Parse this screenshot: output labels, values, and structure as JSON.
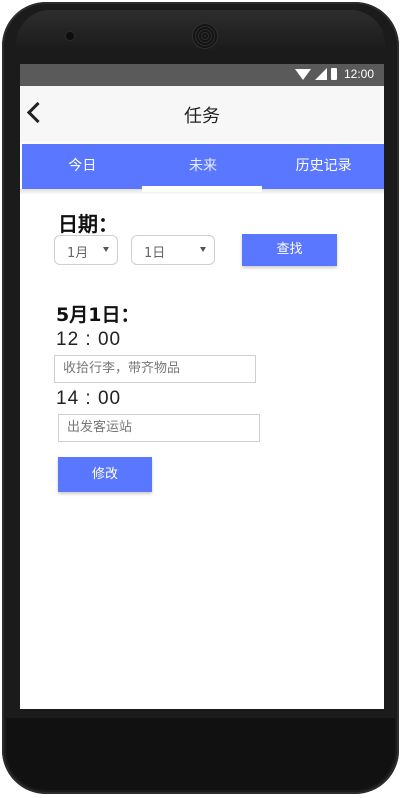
{
  "statusbar": {
    "time": "12:00"
  },
  "header": {
    "title": "任务"
  },
  "tabs": [
    {
      "label": "今日"
    },
    {
      "label": "未来"
    },
    {
      "label": "历史记录"
    }
  ],
  "date_filter": {
    "label": "日期：",
    "month": "1月",
    "day": "1日",
    "search_label": "查找"
  },
  "schedule": {
    "day_title": "5月1日：",
    "items": [
      {
        "time": "12 : 00",
        "task": "收拾行李，带齐物品"
      },
      {
        "time": "14 : 00",
        "task": "出发客运站"
      }
    ],
    "edit_label": "修改"
  },
  "colors": {
    "accent": "#5a78ff",
    "statusbar": "#5a5a5a"
  }
}
